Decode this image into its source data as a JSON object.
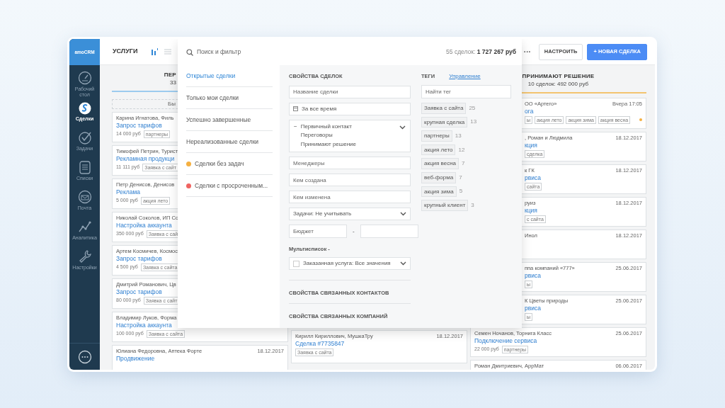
{
  "sidebar": {
    "logo": "amoCRM",
    "items": [
      {
        "label": "Рабочий стол",
        "selected": false
      },
      {
        "label": "Сделки",
        "selected": true
      },
      {
        "label": "Задачи",
        "selected": false
      },
      {
        "label": "Списки",
        "selected": false
      },
      {
        "label": "Почта",
        "selected": false
      },
      {
        "label": "Аналитика",
        "selected": false
      },
      {
        "label": "Настройки",
        "selected": false
      }
    ]
  },
  "topbar": {
    "title": "УСЛУГИ",
    "view_modes": [
      {
        "selected": true
      },
      {
        "selected": false
      }
    ],
    "more": "···",
    "buttons": [
      {
        "label": "НАСТРОИТЬ",
        "kind": "outline"
      },
      {
        "label": "+ НОВАЯ СДЕЛКА",
        "kind": "primary"
      }
    ]
  },
  "board": {
    "columns": [
      {
        "kind": "left_part",
        "title": "ПЕР",
        "subtitle": "33",
        "color": "#9ccbee",
        "quick_add": "Бы",
        "cards": [
          {
            "kind": "left_part",
            "name": "Карина Игнатова, Филь",
            "title": "Запрос тарифов",
            "price": "14 000 руб",
            "tags": [
              "партнеры"
            ]
          },
          {
            "kind": "left_part",
            "name": "Тимофей Петрин, Турист",
            "title": "Рекламная продукци",
            "price": "11 111 руб",
            "tags": [
              "Заявка с сайт"
            ]
          },
          {
            "kind": "left_part",
            "name": "Петр Денисов, Денисов",
            "title": "Реклама",
            "price": "5 000 руб",
            "tags": [
              "акция лето"
            ]
          },
          {
            "kind": "left_part",
            "name": "Николай Соколов, ИП Со",
            "title": "Настройка аккаунта",
            "price": "350 000 руб",
            "tags": [
              "Заявка с сай"
            ]
          },
          {
            "kind": "left_part",
            "name": "Артем Космичев, Космос",
            "title": "Запрос тарифов",
            "price": "4 500 руб",
            "tags": [
              "Заявка с сайта"
            ]
          },
          {
            "kind": "left_part",
            "name": "Дмитрий Романович, Цв",
            "title": "Запрос тарифов",
            "price": "80 000 руб",
            "tags": [
              "Заявка с сайт"
            ]
          },
          {
            "kind": "left_part",
            "name": "Владимир Луков, Форма",
            "title": "Настройка аккаунта",
            "price": "100 000 руб",
            "tags": [
              "Заявка с сайта"
            ]
          },
          {
            "kind": "whole",
            "name": "Юлиана Федоровна, Аптека Форте",
            "date": "18.12.2017",
            "title": "Продвижение"
          }
        ]
      },
      {
        "kind": "lower_part",
        "cards": [
          {
            "kind": "whole",
            "name": "Кирилл Кириллович, МушкаТру",
            "date": "18.12.2017",
            "title": "Сделка #7735847",
            "tags": [
              "Заявка с сайта"
            ]
          }
        ]
      },
      {
        "kind": "right_part",
        "title": "ПРИНИМАЮТ РЕШЕНИЕ",
        "subtitle": "10 сделок: 492 000 руб",
        "color": "#f3c46f",
        "cards": [
          {
            "kind": "right_part",
            "name": "ОО «Артего»",
            "date": "Вчера 17:05",
            "title": "ога",
            "tags": [
              "ы",
              "акция лето",
              "акция зима",
              "акция весна"
            ],
            "color": "#f5b041"
          },
          {
            "kind": "right_part",
            "name": ", Роман и Людмила",
            "date": "18.12.2017",
            "title": "кция",
            "tags": [
              "сделка"
            ]
          },
          {
            "kind": "right_part",
            "name": "к ГК",
            "date": "18.12.2017",
            "title": "рвиса",
            "tags": [
              "сайта"
            ]
          },
          {
            "kind": "right_part",
            "name": "руиз",
            "date": "18.12.2017",
            "title": "кция",
            "tags": [
              "с сайта"
            ]
          },
          {
            "kind": "right_part",
            "name": "Инол",
            "date": "18.12.2017"
          },
          {
            "kind": "right_part",
            "name": "ппа компаний «777»",
            "date": "25.06.2017",
            "title": "рвиса",
            "tags": [
              "ы"
            ]
          },
          {
            "kind": "right_part",
            "name": "К Цветы природы",
            "date": "25.06.2017",
            "title": "рвиса",
            "tags": [
              "ы"
            ]
          },
          {
            "kind": "whole",
            "name": "Семен Ночанов, Торнига Класс",
            "date": "25.06.2017",
            "title": "Подключение сервиса",
            "price": "22 000 руб",
            "tags": [
              "партнеры"
            ]
          },
          {
            "kind": "whole",
            "name": "Роман Дмитриевич, АppМат",
            "date": "06.06.2017"
          }
        ]
      }
    ]
  },
  "filter": {
    "search": {
      "placeholder": "Поиск и фильтр"
    },
    "summary": "55 сделок: **1 727 267 руб**",
    "presets": [
      {
        "label": "Открытые сделки",
        "selected": true
      },
      {
        "label": "Только мои сделки",
        "selected": false
      },
      {
        "label": "Успешно завершенные",
        "selected": false
      },
      {
        "label": "Нереализованные сделки",
        "selected": false
      },
      {
        "label": "Сделки без задач",
        "selected": false,
        "color": "#f5b041"
      },
      {
        "label": "Сделки с просроченным...",
        "selected": false,
        "color": "#ef6461"
      }
    ],
    "properties": {
      "heading": "СВОЙСТВА СДЕЛОК",
      "fields": [
        {
          "kind": "text",
          "placeholder": "Название сделки"
        },
        {
          "kind": "date",
          "value": "За все время"
        },
        {
          "kind": "statuses",
          "toggle": "−",
          "options": [
            "Первичный контакт",
            "Переговоры",
            "Принимают решение"
          ]
        },
        {
          "kind": "text",
          "placeholder": "Менеджеры"
        },
        {
          "kind": "text",
          "placeholder": "Кем создана"
        },
        {
          "kind": "text",
          "placeholder": "Кем изменена"
        },
        {
          "kind": "select",
          "value": "Задачи: Не учитывать"
        },
        {
          "kind": "range",
          "placeholder": "Бюджет",
          "separator": "-"
        },
        {
          "kind": "label",
          "text": "Мультисписок -"
        },
        {
          "kind": "checkselect",
          "value": "Заказанная услуга: Все значения",
          "checked": false
        }
      ],
      "sections": [
        "СВОЙСТВА СВЯЗАННЫХ КОНТАКТОВ",
        "СВОЙСТВА СВЯЗАННЫХ КОМПАНИЙ"
      ]
    },
    "tags": {
      "heading": "ТЕГИ",
      "manage": "Управление",
      "search": {
        "placeholder": "Найти тег"
      },
      "items": [
        {
          "label": "Заявка с сайта",
          "count": "25"
        },
        {
          "label": "крупная сделка",
          "count": "13"
        },
        {
          "label": "партнеры",
          "count": "13"
        },
        {
          "label": "акция лето",
          "count": "12"
        },
        {
          "label": "акция весна",
          "count": "7"
        },
        {
          "label": "веб-форма",
          "count": "7"
        },
        {
          "label": "акция зима",
          "count": "5"
        },
        {
          "label": "крупный клиент",
          "count": "3"
        }
      ]
    }
  }
}
